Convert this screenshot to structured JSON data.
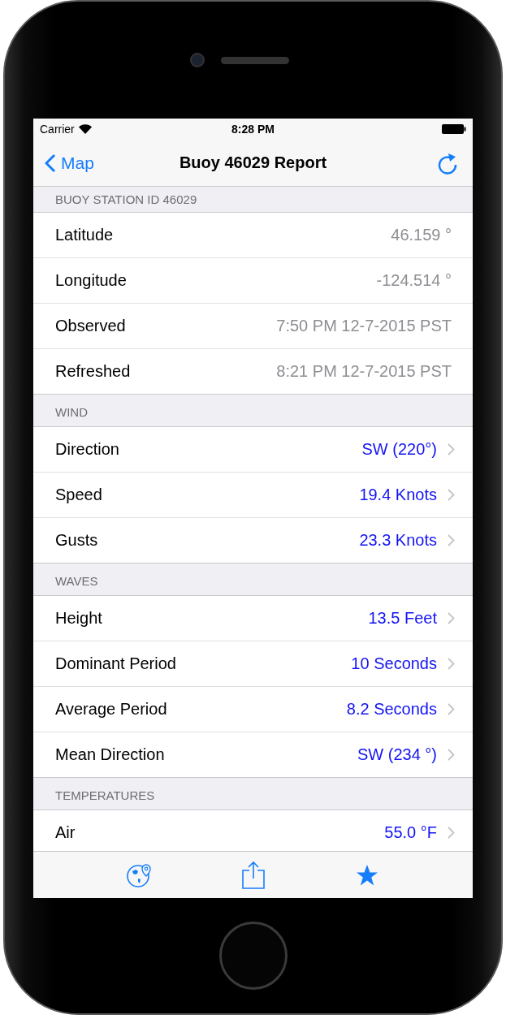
{
  "status_bar": {
    "carrier": "Carrier",
    "time": "8:28 PM"
  },
  "nav": {
    "back": "Map",
    "title": "Buoy 46029 Report"
  },
  "sections": [
    {
      "header": "BUOY STATION ID 46029",
      "rows": [
        {
          "label": "Latitude",
          "value": "46.159 °",
          "kind": "info"
        },
        {
          "label": "Longitude",
          "value": "-124.514 °",
          "kind": "info"
        },
        {
          "label": "Observed",
          "value": "7:50 PM 12-7-2015 PST",
          "kind": "info"
        },
        {
          "label": "Refreshed",
          "value": "8:21 PM 12-7-2015 PST",
          "kind": "info"
        }
      ]
    },
    {
      "header": "WIND",
      "rows": [
        {
          "label": "Direction",
          "value": "SW (220°)",
          "kind": "link"
        },
        {
          "label": "Speed",
          "value": "19.4 Knots",
          "kind": "link"
        },
        {
          "label": "Gusts",
          "value": "23.3 Knots",
          "kind": "link"
        }
      ]
    },
    {
      "header": "WAVES",
      "rows": [
        {
          "label": "Height",
          "value": "13.5 Feet",
          "kind": "link"
        },
        {
          "label": "Dominant Period",
          "value": "10 Seconds",
          "kind": "link"
        },
        {
          "label": "Average Period",
          "value": "8.2 Seconds",
          "kind": "link"
        },
        {
          "label": "Mean Direction",
          "value": "SW (234 °)",
          "kind": "link"
        }
      ]
    },
    {
      "header": "TEMPERATURES",
      "rows": [
        {
          "label": "Air",
          "value": "55.0 °F",
          "kind": "link"
        }
      ]
    }
  ],
  "tab_bar": [
    {
      "kind": "map"
    },
    {
      "kind": "share"
    },
    {
      "kind": "favorite"
    }
  ]
}
